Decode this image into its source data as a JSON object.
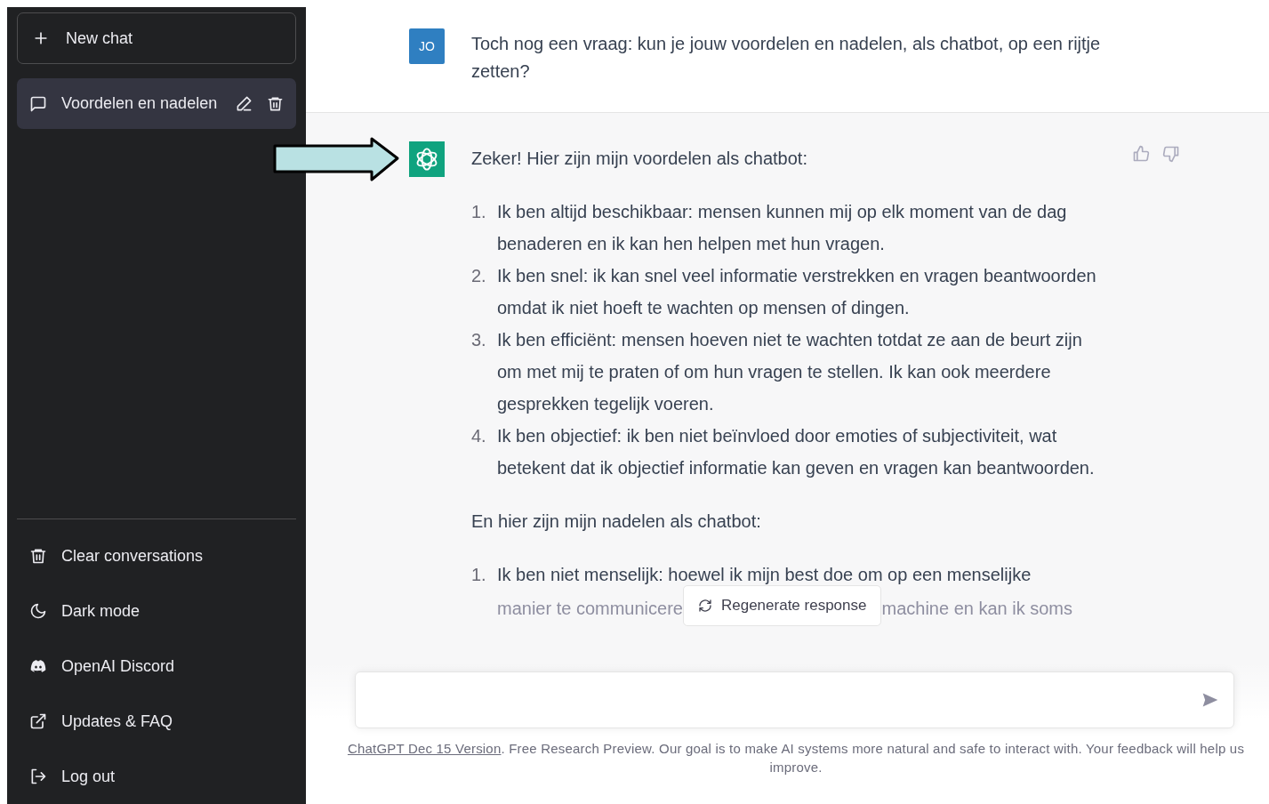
{
  "sidebar": {
    "new_chat": {
      "label": "New chat"
    },
    "conversations": [
      {
        "title": "Voordelen en nadelen",
        "selected": true
      }
    ],
    "menu": [
      {
        "kind": "trash",
        "label": "Clear conversations"
      },
      {
        "kind": "moon",
        "label": "Dark mode"
      },
      {
        "kind": "discord",
        "label": "OpenAI Discord"
      },
      {
        "kind": "external",
        "label": "Updates & FAQ"
      },
      {
        "kind": "logout",
        "label": "Log out"
      }
    ]
  },
  "conversation": {
    "user": {
      "avatar": "JO",
      "text": "Toch nog een vraag: kun je jouw voordelen en nadelen, als chatbot, op een rijtje zetten?"
    },
    "assistant": {
      "intro": "Zeker! Hier zijn mijn voordelen als chatbot:",
      "pros": [
        {
          "number": "1.",
          "text": "Ik ben altijd beschikbaar: mensen kunnen mij op elk moment van de dag benaderen en ik kan hen helpen met hun vragen."
        },
        {
          "number": "2.",
          "text": "Ik ben snel: ik kan snel veel informatie verstrekken en vragen beantwoorden omdat ik niet hoeft te wachten op mensen of dingen."
        },
        {
          "number": "3.",
          "text": "Ik ben efficiënt: mensen hoeven niet te wachten totdat ze aan de beurt zijn om met mij te praten of om hun vragen te stellen. Ik kan ook meerdere gesprekken tegelijk voeren."
        },
        {
          "number": "4.",
          "text": "Ik ben objectief: ik ben niet beïnvloed door emoties of subjectiviteit, wat betekent dat ik objectief informatie kan geven en vragen kan beantwoorden."
        }
      ],
      "cons_intro": "En hier zijn mijn nadelen als chatbot:",
      "cons": [
        {
          "number": "1.",
          "text": "Ik ben niet menselijk: hoewel ik mijn best doe om op een menselijke",
          "text_left": "manier te communicere",
          "text_right": "machine en kan ik soms"
        }
      ]
    }
  },
  "regenerate_button": {
    "label": "Regenerate response"
  },
  "footer": {
    "link": "ChatGPT Dec 15 Version",
    "text": ". Free Research Preview. Our goal is to make AI systems more natural and safe to interact with. Your feedback will help us improve."
  }
}
